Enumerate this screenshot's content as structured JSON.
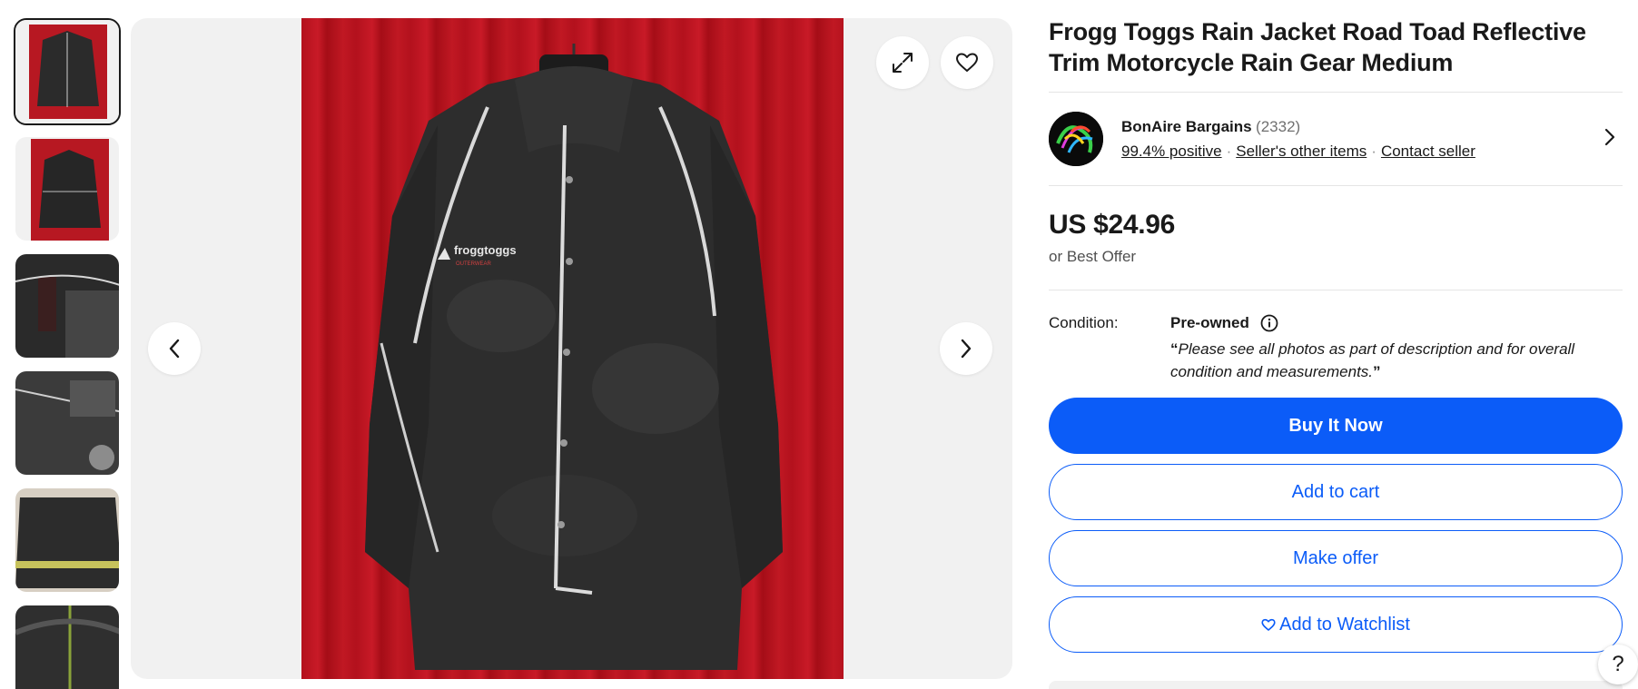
{
  "listing": {
    "title": "Frogg Toggs Rain Jacket Road Toad Reflective Trim Motorcycle Rain Gear Medium"
  },
  "gallery": {
    "thumbnail_count": 6,
    "selected_index": 0,
    "expand_icon": "expand-icon",
    "favorite_icon": "heart-icon",
    "prev_icon": "chevron-left-icon",
    "next_icon": "chevron-right-icon",
    "logo_text": "froggtoggs",
    "logo_subtext": "OUTERWEAR"
  },
  "seller": {
    "name": "BonAire Bargains",
    "feedback_count": "(2332)",
    "positive": "99.4% positive",
    "other_items": "Seller's other items",
    "contact": "Contact seller",
    "logo_text": "BonAire Bargains"
  },
  "price": {
    "amount": "US $24.96",
    "best_offer": "or Best Offer"
  },
  "condition": {
    "label": "Condition:",
    "value": "Pre-owned",
    "note": "Please see all photos as part of description and for overall condition and measurements."
  },
  "actions": {
    "buy_now": "Buy It Now",
    "add_to_cart": "Add to cart",
    "make_offer": "Make offer",
    "watchlist": "Add to Watchlist"
  },
  "help": {
    "label": "?"
  },
  "colors": {
    "primary": "#0b5cf8",
    "text": "#191919",
    "muted": "#707070"
  }
}
